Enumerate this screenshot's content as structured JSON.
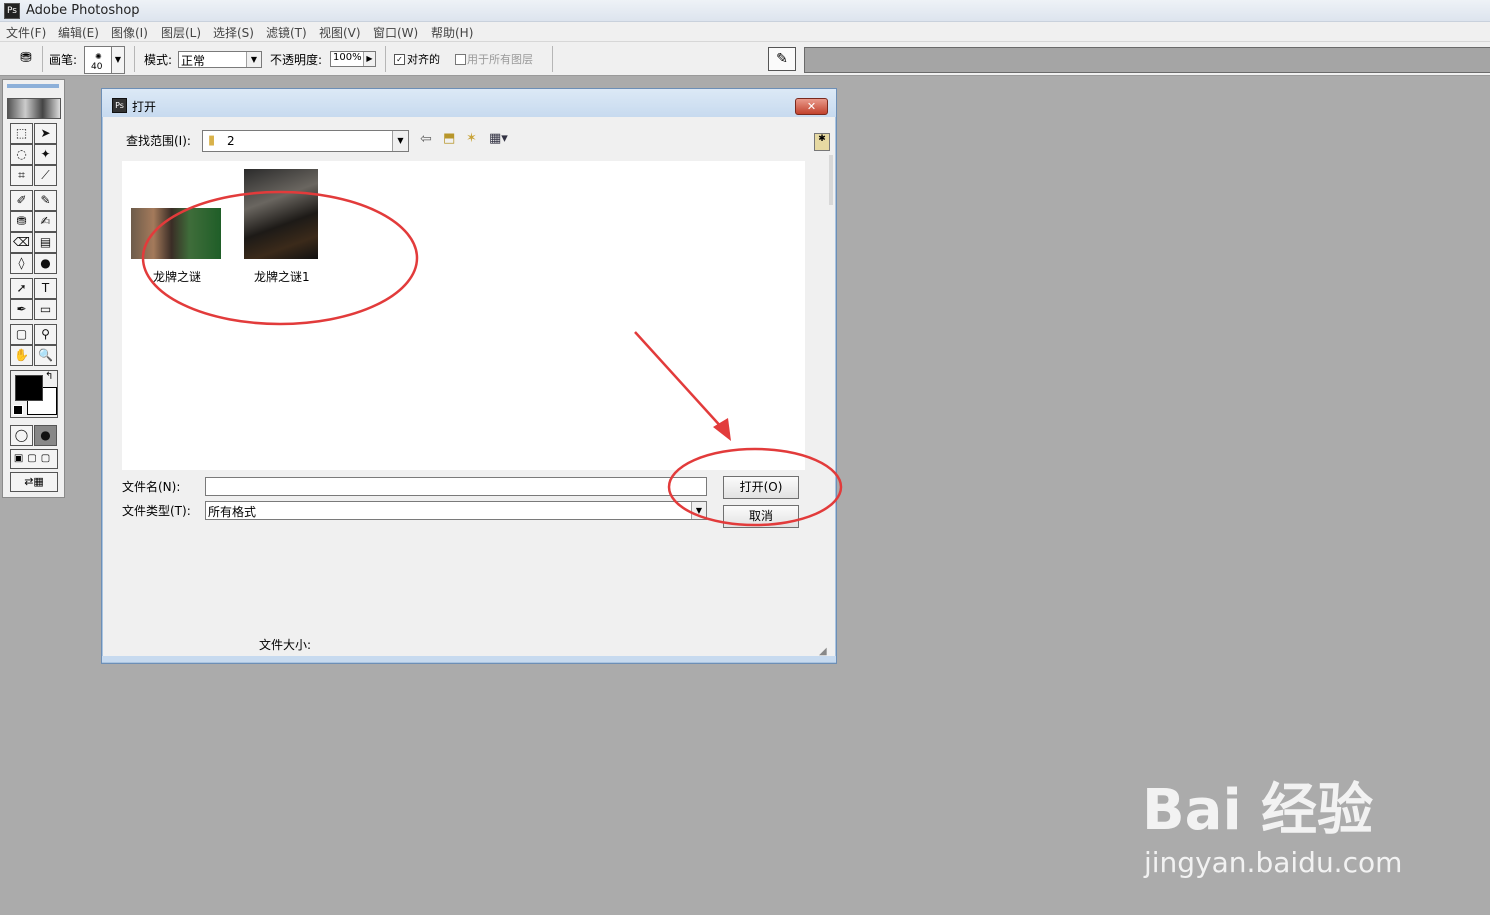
{
  "app": {
    "title": "Adobe Photoshop"
  },
  "menu": [
    "文件(F)",
    "编辑(E)",
    "图像(I)",
    "图层(L)",
    "选择(S)",
    "滤镜(T)",
    "视图(V)",
    "窗口(W)",
    "帮助(H)"
  ],
  "options": {
    "brush_label": "画笔:",
    "brush_size": "40",
    "mode_label": "模式:",
    "mode_value": "正常",
    "opacity_label": "不透明度:",
    "opacity_value": "100%",
    "aligned_label": "对齐的",
    "all_layers_label": "用于所有图层"
  },
  "dialog": {
    "title": "打开",
    "lookin_label": "查找范围(I):",
    "lookin_value": "2",
    "files": [
      {
        "name": "龙牌之谜"
      },
      {
        "name": "龙牌之谜1"
      }
    ],
    "filename_label": "文件名(N):",
    "filename_value": "",
    "filetype_label": "文件类型(T):",
    "filetype_value": "所有格式",
    "open_button": "打开(O)",
    "cancel_button": "取消",
    "filesize_label": "文件大小:"
  },
  "colors": {
    "annotation": "#e23b3b",
    "desktop": "#ababab"
  },
  "watermark": {
    "brand": "Bai 经验",
    "url": "jingyan.baidu.com"
  }
}
